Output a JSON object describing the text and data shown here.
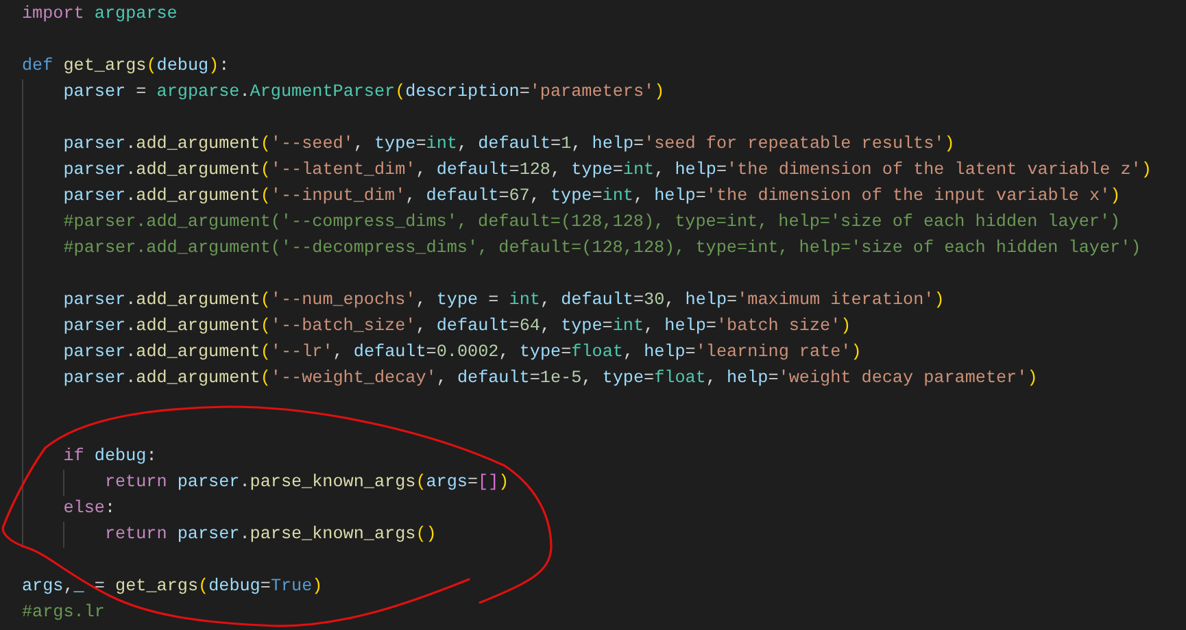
{
  "editor": {
    "lines": [
      {
        "kind": "code",
        "tokens": [
          {
            "kind": "kw",
            "t": "import "
          },
          {
            "kind": "mod",
            "t": "argparse"
          }
        ]
      },
      {
        "kind": "blank"
      },
      {
        "kind": "code",
        "tokens": [
          {
            "kind": "def",
            "t": "def "
          },
          {
            "kind": "fn",
            "t": "get_args"
          },
          {
            "kind": "b1",
            "t": "("
          },
          {
            "kind": "var",
            "t": "debug"
          },
          {
            "kind": "b1",
            "t": ")"
          },
          {
            "kind": "p",
            "t": ":"
          }
        ],
        "children": [
          {
            "kind": "code",
            "tokens": [
              {
                "kind": "var",
                "t": "parser"
              },
              {
                "kind": "p",
                "t": " = "
              },
              {
                "kind": "mod",
                "t": "argparse"
              },
              {
                "kind": "p",
                "t": "."
              },
              {
                "kind": "mod",
                "t": "ArgumentParser"
              },
              {
                "kind": "b1",
                "t": "("
              },
              {
                "kind": "var",
                "t": "description"
              },
              {
                "kind": "p",
                "t": "="
              },
              {
                "kind": "str",
                "t": "'parameters'"
              },
              {
                "kind": "b1",
                "t": ")"
              }
            ]
          },
          {
            "kind": "blank"
          },
          {
            "kind": "code",
            "tokens": [
              {
                "kind": "var",
                "t": "parser"
              },
              {
                "kind": "p",
                "t": "."
              },
              {
                "kind": "fn",
                "t": "add_argument"
              },
              {
                "kind": "b1",
                "t": "("
              },
              {
                "kind": "str",
                "t": "'--seed'"
              },
              {
                "kind": "p",
                "t": ", "
              },
              {
                "kind": "var",
                "t": "type"
              },
              {
                "kind": "p",
                "t": "="
              },
              {
                "kind": "mod",
                "t": "int"
              },
              {
                "kind": "p",
                "t": ", "
              },
              {
                "kind": "var",
                "t": "default"
              },
              {
                "kind": "p",
                "t": "="
              },
              {
                "kind": "num",
                "t": "1"
              },
              {
                "kind": "p",
                "t": ", "
              },
              {
                "kind": "var",
                "t": "help"
              },
              {
                "kind": "p",
                "t": "="
              },
              {
                "kind": "str",
                "t": "'seed for repeatable results'"
              },
              {
                "kind": "b1",
                "t": ")"
              }
            ]
          },
          {
            "kind": "code",
            "tokens": [
              {
                "kind": "var",
                "t": "parser"
              },
              {
                "kind": "p",
                "t": "."
              },
              {
                "kind": "fn",
                "t": "add_argument"
              },
              {
                "kind": "b1",
                "t": "("
              },
              {
                "kind": "str",
                "t": "'--latent_dim'"
              },
              {
                "kind": "p",
                "t": ", "
              },
              {
                "kind": "var",
                "t": "default"
              },
              {
                "kind": "p",
                "t": "="
              },
              {
                "kind": "num",
                "t": "128"
              },
              {
                "kind": "p",
                "t": ", "
              },
              {
                "kind": "var",
                "t": "type"
              },
              {
                "kind": "p",
                "t": "="
              },
              {
                "kind": "mod",
                "t": "int"
              },
              {
                "kind": "p",
                "t": ", "
              },
              {
                "kind": "var",
                "t": "help"
              },
              {
                "kind": "p",
                "t": "="
              },
              {
                "kind": "str",
                "t": "'the dimension of the latent variable z'"
              },
              {
                "kind": "b1",
                "t": ")"
              }
            ]
          },
          {
            "kind": "code",
            "tokens": [
              {
                "kind": "var",
                "t": "parser"
              },
              {
                "kind": "p",
                "t": "."
              },
              {
                "kind": "fn",
                "t": "add_argument"
              },
              {
                "kind": "b1",
                "t": "("
              },
              {
                "kind": "str",
                "t": "'--input_dim'"
              },
              {
                "kind": "p",
                "t": ", "
              },
              {
                "kind": "var",
                "t": "default"
              },
              {
                "kind": "p",
                "t": "="
              },
              {
                "kind": "num",
                "t": "67"
              },
              {
                "kind": "p",
                "t": ", "
              },
              {
                "kind": "var",
                "t": "type"
              },
              {
                "kind": "p",
                "t": "="
              },
              {
                "kind": "mod",
                "t": "int"
              },
              {
                "kind": "p",
                "t": ", "
              },
              {
                "kind": "var",
                "t": "help"
              },
              {
                "kind": "p",
                "t": "="
              },
              {
                "kind": "str",
                "t": "'the dimension of the input variable x'"
              },
              {
                "kind": "b1",
                "t": ")"
              }
            ]
          },
          {
            "kind": "code",
            "tokens": [
              {
                "kind": "cm",
                "t": "#parser.add_argument('--compress_dims', default=(128,128), type=int, help='size of each hidden layer')"
              }
            ]
          },
          {
            "kind": "code",
            "tokens": [
              {
                "kind": "cm",
                "t": "#parser.add_argument('--decompress_dims', default=(128,128), type=int, help='size of each hidden layer')"
              }
            ]
          },
          {
            "kind": "blank"
          },
          {
            "kind": "code",
            "tokens": [
              {
                "kind": "var",
                "t": "parser"
              },
              {
                "kind": "p",
                "t": "."
              },
              {
                "kind": "fn",
                "t": "add_argument"
              },
              {
                "kind": "b1",
                "t": "("
              },
              {
                "kind": "str",
                "t": "'--num_epochs'"
              },
              {
                "kind": "p",
                "t": ", "
              },
              {
                "kind": "var",
                "t": "type"
              },
              {
                "kind": "p",
                "t": " = "
              },
              {
                "kind": "mod",
                "t": "int"
              },
              {
                "kind": "p",
                "t": ", "
              },
              {
                "kind": "var",
                "t": "default"
              },
              {
                "kind": "p",
                "t": "="
              },
              {
                "kind": "num",
                "t": "30"
              },
              {
                "kind": "p",
                "t": ", "
              },
              {
                "kind": "var",
                "t": "help"
              },
              {
                "kind": "p",
                "t": "="
              },
              {
                "kind": "str",
                "t": "'maximum iteration'"
              },
              {
                "kind": "b1",
                "t": ")"
              }
            ]
          },
          {
            "kind": "code",
            "tokens": [
              {
                "kind": "var",
                "t": "parser"
              },
              {
                "kind": "p",
                "t": "."
              },
              {
                "kind": "fn",
                "t": "add_argument"
              },
              {
                "kind": "b1",
                "t": "("
              },
              {
                "kind": "str",
                "t": "'--batch_size'"
              },
              {
                "kind": "p",
                "t": ", "
              },
              {
                "kind": "var",
                "t": "default"
              },
              {
                "kind": "p",
                "t": "="
              },
              {
                "kind": "num",
                "t": "64"
              },
              {
                "kind": "p",
                "t": ", "
              },
              {
                "kind": "var",
                "t": "type"
              },
              {
                "kind": "p",
                "t": "="
              },
              {
                "kind": "mod",
                "t": "int"
              },
              {
                "kind": "p",
                "t": ", "
              },
              {
                "kind": "var",
                "t": "help"
              },
              {
                "kind": "p",
                "t": "="
              },
              {
                "kind": "str",
                "t": "'batch size'"
              },
              {
                "kind": "b1",
                "t": ")"
              }
            ]
          },
          {
            "kind": "code",
            "tokens": [
              {
                "kind": "var",
                "t": "parser"
              },
              {
                "kind": "p",
                "t": "."
              },
              {
                "kind": "fn",
                "t": "add_argument"
              },
              {
                "kind": "b1",
                "t": "("
              },
              {
                "kind": "str",
                "t": "'--lr'"
              },
              {
                "kind": "p",
                "t": ", "
              },
              {
                "kind": "var",
                "t": "default"
              },
              {
                "kind": "p",
                "t": "="
              },
              {
                "kind": "num",
                "t": "0.0002"
              },
              {
                "kind": "p",
                "t": ", "
              },
              {
                "kind": "var",
                "t": "type"
              },
              {
                "kind": "p",
                "t": "="
              },
              {
                "kind": "mod",
                "t": "float"
              },
              {
                "kind": "p",
                "t": ", "
              },
              {
                "kind": "var",
                "t": "help"
              },
              {
                "kind": "p",
                "t": "="
              },
              {
                "kind": "str",
                "t": "'learning rate'"
              },
              {
                "kind": "b1",
                "t": ")"
              }
            ]
          },
          {
            "kind": "code",
            "tokens": [
              {
                "kind": "var",
                "t": "parser"
              },
              {
                "kind": "p",
                "t": "."
              },
              {
                "kind": "fn",
                "t": "add_argument"
              },
              {
                "kind": "b1",
                "t": "("
              },
              {
                "kind": "str",
                "t": "'--weight_decay'"
              },
              {
                "kind": "p",
                "t": ", "
              },
              {
                "kind": "var",
                "t": "default"
              },
              {
                "kind": "p",
                "t": "="
              },
              {
                "kind": "num",
                "t": "1e-5"
              },
              {
                "kind": "p",
                "t": ", "
              },
              {
                "kind": "var",
                "t": "type"
              },
              {
                "kind": "p",
                "t": "="
              },
              {
                "kind": "mod",
                "t": "float"
              },
              {
                "kind": "p",
                "t": ", "
              },
              {
                "kind": "var",
                "t": "help"
              },
              {
                "kind": "p",
                "t": "="
              },
              {
                "kind": "str",
                "t": "'weight decay parameter'"
              },
              {
                "kind": "b1",
                "t": ")"
              }
            ]
          },
          {
            "kind": "blank"
          },
          {
            "kind": "blank"
          },
          {
            "kind": "code",
            "tokens": [
              {
                "kind": "kw",
                "t": "if "
              },
              {
                "kind": "var",
                "t": "debug"
              },
              {
                "kind": "p",
                "t": ":"
              }
            ],
            "children": [
              {
                "kind": "code",
                "tokens": [
                  {
                    "kind": "kw",
                    "t": "return "
                  },
                  {
                    "kind": "var",
                    "t": "parser"
                  },
                  {
                    "kind": "p",
                    "t": "."
                  },
                  {
                    "kind": "fn",
                    "t": "parse_known_args"
                  },
                  {
                    "kind": "b1",
                    "t": "("
                  },
                  {
                    "kind": "var",
                    "t": "args"
                  },
                  {
                    "kind": "p",
                    "t": "="
                  },
                  {
                    "kind": "b2",
                    "t": "[]"
                  },
                  {
                    "kind": "b1",
                    "t": ")"
                  }
                ]
              }
            ]
          },
          {
            "kind": "code",
            "tokens": [
              {
                "kind": "kw",
                "t": "else"
              },
              {
                "kind": "p",
                "t": ":"
              }
            ],
            "children": [
              {
                "kind": "code",
                "tokens": [
                  {
                    "kind": "kw",
                    "t": "return "
                  },
                  {
                    "kind": "var",
                    "t": "parser"
                  },
                  {
                    "kind": "p",
                    "t": "."
                  },
                  {
                    "kind": "fn",
                    "t": "parse_known_args"
                  },
                  {
                    "kind": "b1",
                    "t": "()"
                  }
                ]
              }
            ]
          }
        ]
      },
      {
        "kind": "blank"
      },
      {
        "kind": "code",
        "tokens": [
          {
            "kind": "var",
            "t": "args"
          },
          {
            "kind": "p",
            "t": ","
          },
          {
            "kind": "var",
            "t": "_"
          },
          {
            "kind": "p",
            "t": " = "
          },
          {
            "kind": "fn",
            "t": "get_args"
          },
          {
            "kind": "b1",
            "t": "("
          },
          {
            "kind": "var",
            "t": "debug"
          },
          {
            "kind": "p",
            "t": "="
          },
          {
            "kind": "def",
            "t": "True"
          },
          {
            "kind": "b1",
            "t": ")"
          }
        ]
      },
      {
        "kind": "code",
        "tokens": [
          {
            "kind": "cm",
            "t": "#args.lr"
          }
        ]
      }
    ]
  }
}
